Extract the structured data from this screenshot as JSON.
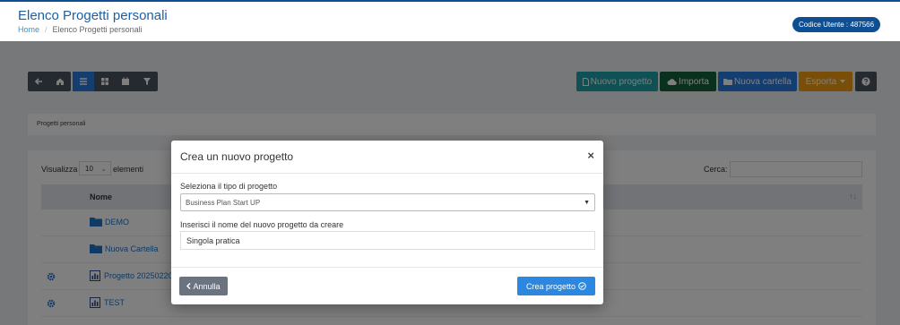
{
  "header": {
    "title": "Elenco Progetti personali",
    "breadcrumb_home": "Home",
    "breadcrumb_sep": "/",
    "breadcrumb_current": "Elenco Progetti personali",
    "user_code": "Codice Utente : 487566"
  },
  "toolbar": {
    "new_project": "Nuovo progetto",
    "import": "Importa",
    "new_folder": "Nuova cartella",
    "export": "Esporta",
    "help_icon": "question-icon"
  },
  "panel": {
    "label": "Progetti personali"
  },
  "table": {
    "show_label": "Visualizza",
    "page_length": "10",
    "elements_label": "elementi",
    "search_label": "Cerca:",
    "col_name": "Nome",
    "rows": [
      {
        "type": "folder",
        "name": "DEMO",
        "date": "",
        "desc": ""
      },
      {
        "type": "folder",
        "name": "Nuova Cartella",
        "date": "",
        "desc": ""
      },
      {
        "type": "project",
        "name": "Progetto 20250220",
        "date": "",
        "desc": ""
      },
      {
        "type": "project",
        "name": "TEST",
        "date": "",
        "desc": ""
      }
    ]
  },
  "modal": {
    "title": "Crea un nuovo progetto",
    "close": "×",
    "type_label": "Seleziona il tipo di progetto",
    "type_value": "Business Plan Start UP",
    "name_label": "Inserisci il nome del nuovo progetto da creare",
    "name_value": "Singola pratica",
    "cancel": "Annulla",
    "create": "Crea progetto"
  },
  "colors": {
    "brand": "#0e4f94",
    "teal": "#1ea2a8",
    "green": "#15613c",
    "blue": "#2b7de0",
    "orange": "#f39c12",
    "dark": "#4b5563"
  }
}
